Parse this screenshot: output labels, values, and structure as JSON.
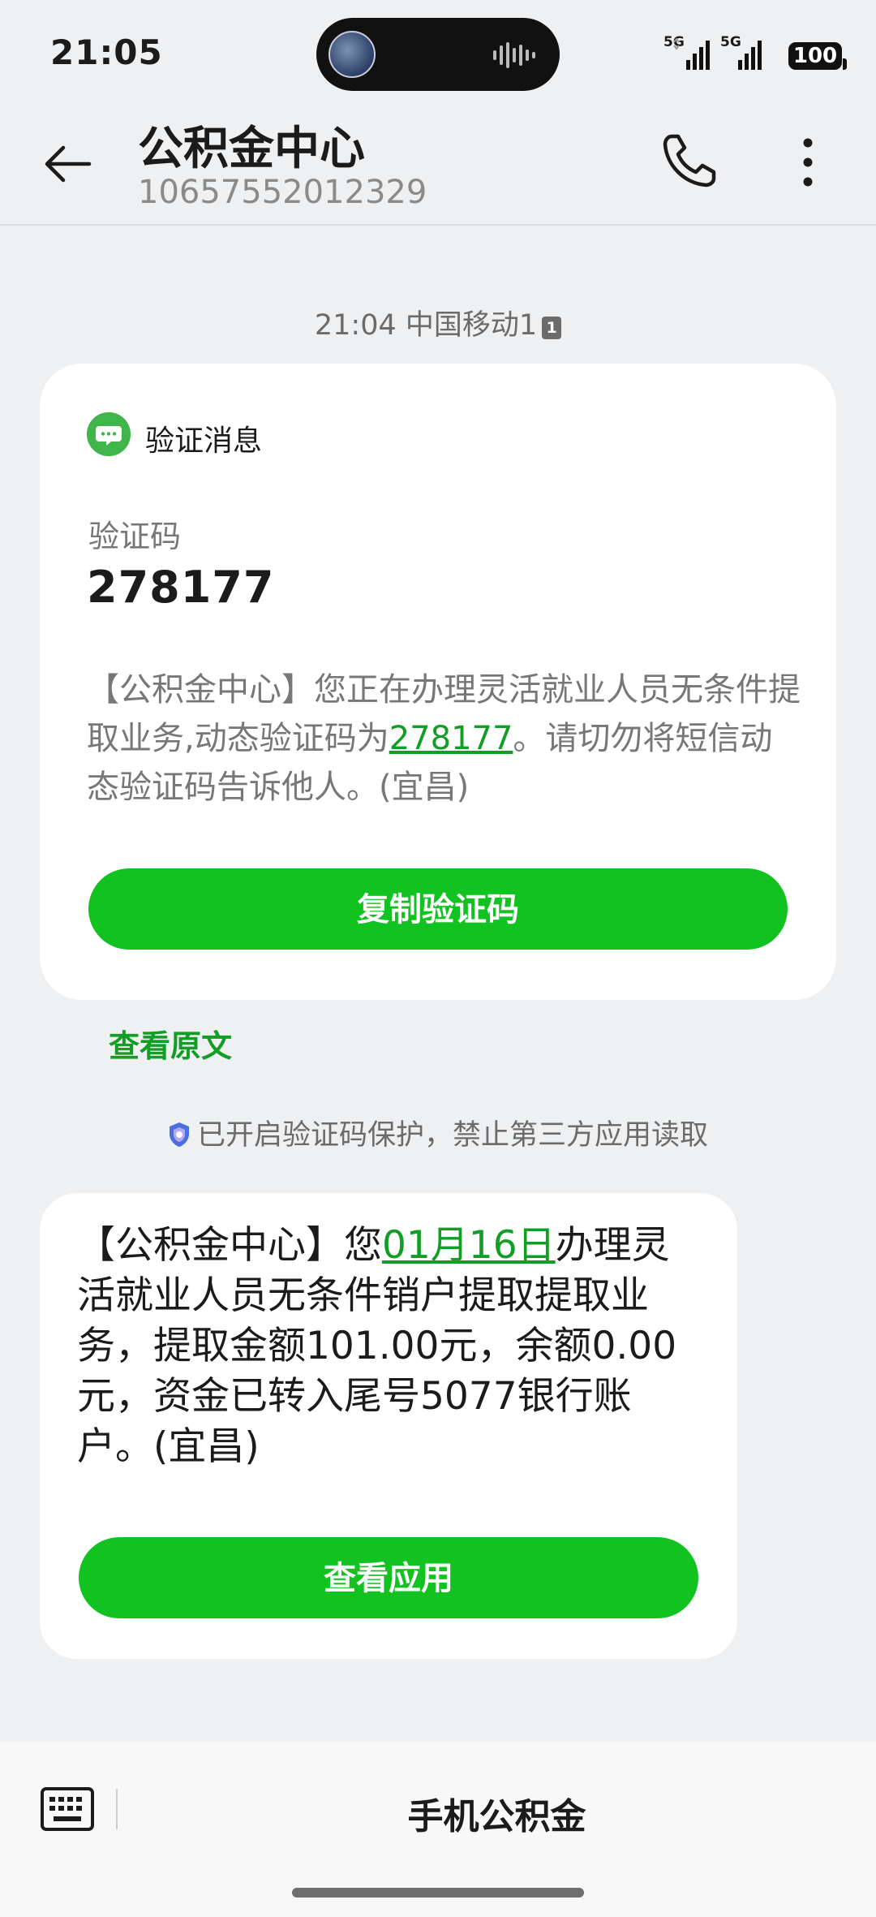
{
  "status_bar": {
    "time": "21:05",
    "signal1_label": "5G",
    "signal2_label": "5G",
    "battery": "100"
  },
  "header": {
    "title": "公积金中心",
    "number": "10657552012329",
    "icons": [
      "back-arrow-icon",
      "phone-icon",
      "more-vertical-icon"
    ]
  },
  "conversation": {
    "timestamp": "21:04 中国移动1",
    "sim_badge": "1"
  },
  "verify_card": {
    "title": "验证消息",
    "code_label": "验证码",
    "code": "278177",
    "message_prefix": "【公积金中心】您正在办理灵活就业人员无条件提取业务,动态验证码为",
    "message_code": "278177",
    "message_suffix": "。请切勿将短信动态验证码告诉他人。(宜昌)",
    "copy_button": "复制验证码",
    "view_original": "查看原文"
  },
  "protection_notice": "已开启验证码保护，禁止第三方应用读取",
  "message2": {
    "prefix": "【公积金中心】您",
    "date_link": "01月16日",
    "suffix": "办理灵活就业人员无条件销户提取提取业务，提取金额101.00元，余额0.00元，资金已转入尾号5077银行账户。(宜昌)",
    "button": "查看应用"
  },
  "bottom_bar": {
    "menu_label": "手机公积金"
  },
  "colors": {
    "accent_green": "#11c221",
    "link_green": "#129d25",
    "background": "#eff0f2"
  }
}
